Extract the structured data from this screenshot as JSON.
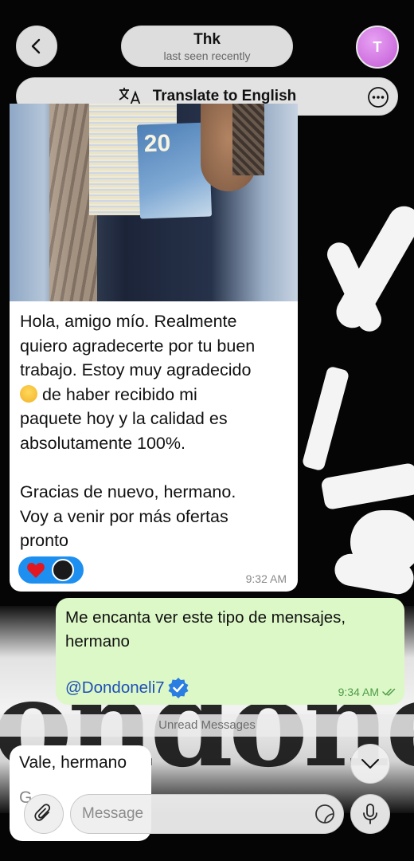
{
  "header": {
    "contact_name": "Thk",
    "status": "last seen recently",
    "avatar_initial": "T",
    "avatar_color": "#c35ad6"
  },
  "translate_bar": {
    "label": "Translate to English",
    "icon": "translate-icon",
    "more_icon": "more-options-icon"
  },
  "messages": {
    "received_1": {
      "image": "photo-of-cash-euro-notes",
      "note_value": "20",
      "text_before_emoji": "Hola, amigo mío. Realmente\nquiero agradecerte por tu buen\ntrabajo. Estoy muy agradecido\n",
      "emoji": "crying-face-emoji",
      "text_after_emoji": " de haber recibido mi\npaquete hoy y la calidad es\nabsolutamente 100%.\n\nGracias de nuevo, hermano.\nVoy a venir por más ofertas\npronto",
      "reactions": [
        "heart-emoji",
        "user-avatar"
      ],
      "time": "9:32 AM"
    },
    "sent_1": {
      "text": "Me encanta ver este tipo de mensajes, hermano",
      "mention": "@Dondoneli7",
      "time": "9:34 AM",
      "status_icon": "double-check-icon"
    },
    "unread_label": "Unread Messages",
    "received_2": {
      "text": "Vale, hermano",
      "partial_next": "G"
    }
  },
  "input": {
    "placeholder": "Message"
  },
  "colors": {
    "sent_bubble": "#dcf8c6",
    "received_bubble": "#ffffff",
    "reaction_pill": "#1d8ff0",
    "mention": "#1f4fb8",
    "sent_time": "#4e9c48"
  }
}
